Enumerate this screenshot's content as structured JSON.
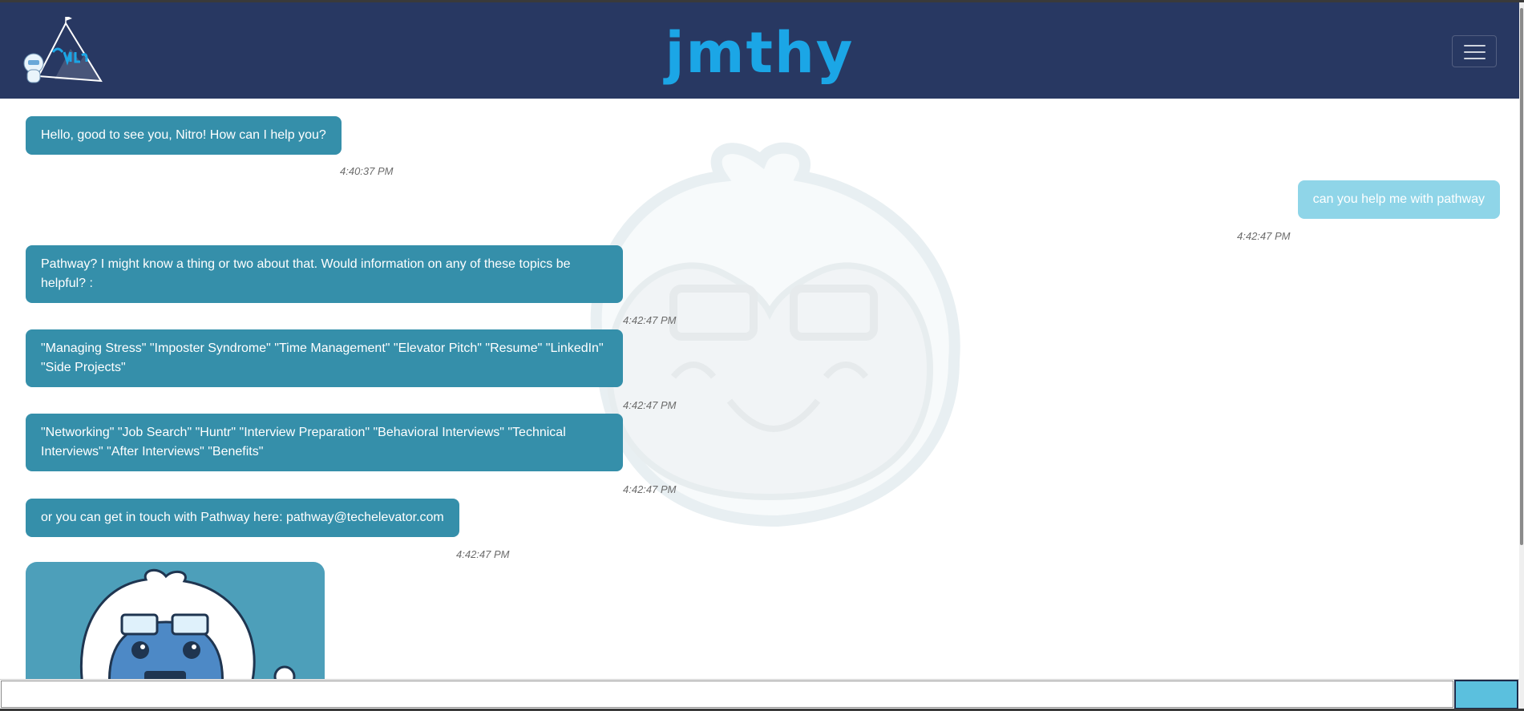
{
  "header": {
    "brand": "jmthy",
    "logo_text": "jmthy"
  },
  "messages": [
    {
      "from": "bot",
      "text": "Hello, good to see you, Nitro! How can I help you?",
      "time": "4:40:37 PM"
    },
    {
      "from": "user",
      "text": "can you help me with pathway",
      "time": "4:42:47 PM"
    },
    {
      "from": "bot",
      "text": "Pathway? I might know a thing or two about that. Would information on any of these topics be helpful? :",
      "time": "4:42:47 PM"
    },
    {
      "from": "bot",
      "text": "\"Managing Stress\" \"Imposter Syndrome\" \"Time Management\" \"Elevator Pitch\" \"Resume\" \"LinkedIn\" \"Side Projects\"",
      "time": "4:42:47 PM"
    },
    {
      "from": "bot",
      "text": "\"Networking\" \"Job Search\" \"Huntr\" \"Interview Preparation\" \"Behavioral Interviews\" \"Technical Interviews\" \"After Interviews\" \"Benefits\"",
      "time": "4:42:47 PM"
    },
    {
      "from": "bot",
      "text": "or you can get in touch with Pathway here: pathway@techelevator.com",
      "time": "4:42:47 PM"
    }
  ],
  "input": {
    "value": "",
    "placeholder": ""
  },
  "colors": {
    "navbar": "#283862",
    "brand": "#1ba6e6",
    "bot_bubble": "#358faa",
    "user_bubble": "#8fd5e8",
    "send": "#5bc0de"
  },
  "icons": {
    "logo": "yeti-mountain-logo",
    "menu": "hamburger-menu-icon",
    "watermark": "yeti-face-watermark",
    "mascot": "yeti-mascot-image"
  }
}
